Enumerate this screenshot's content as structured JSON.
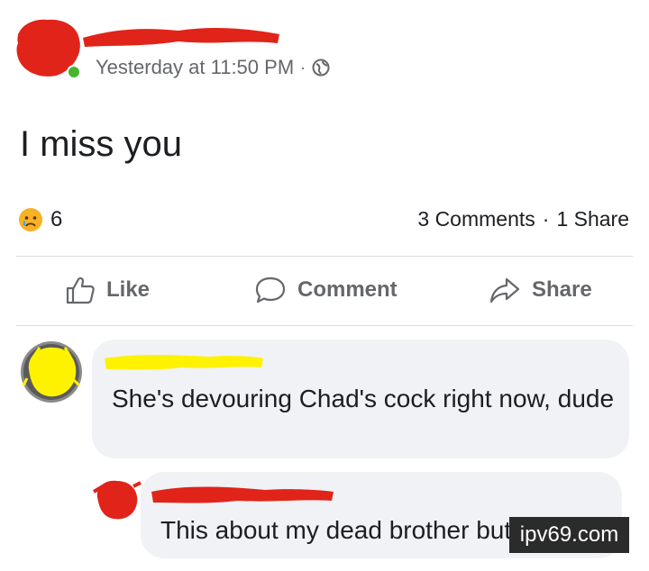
{
  "post": {
    "timestamp": "Yesterday at 11:50 PM",
    "separator": "·",
    "privacy_icon": "globe-icon",
    "text": "I miss you"
  },
  "reactions": {
    "emoji_icon": "crying-face-icon",
    "count": "6",
    "comments": "3 Comments",
    "separator": "·",
    "shares": "1 Share"
  },
  "actions": {
    "like": "Like",
    "comment": "Comment",
    "share": "Share"
  },
  "comments": [
    {
      "text": "She's devouring Chad's cock right now, dude"
    },
    {
      "text": "This about my dead brother but ight"
    }
  ],
  "watermark": "ipv69.com",
  "colors": {
    "redaction_red": "#e0241a",
    "redaction_yellow": "#fff200",
    "online_green": "#42b72a",
    "muted_text": "#65676b",
    "bubble_bg": "#f0f2f5"
  }
}
